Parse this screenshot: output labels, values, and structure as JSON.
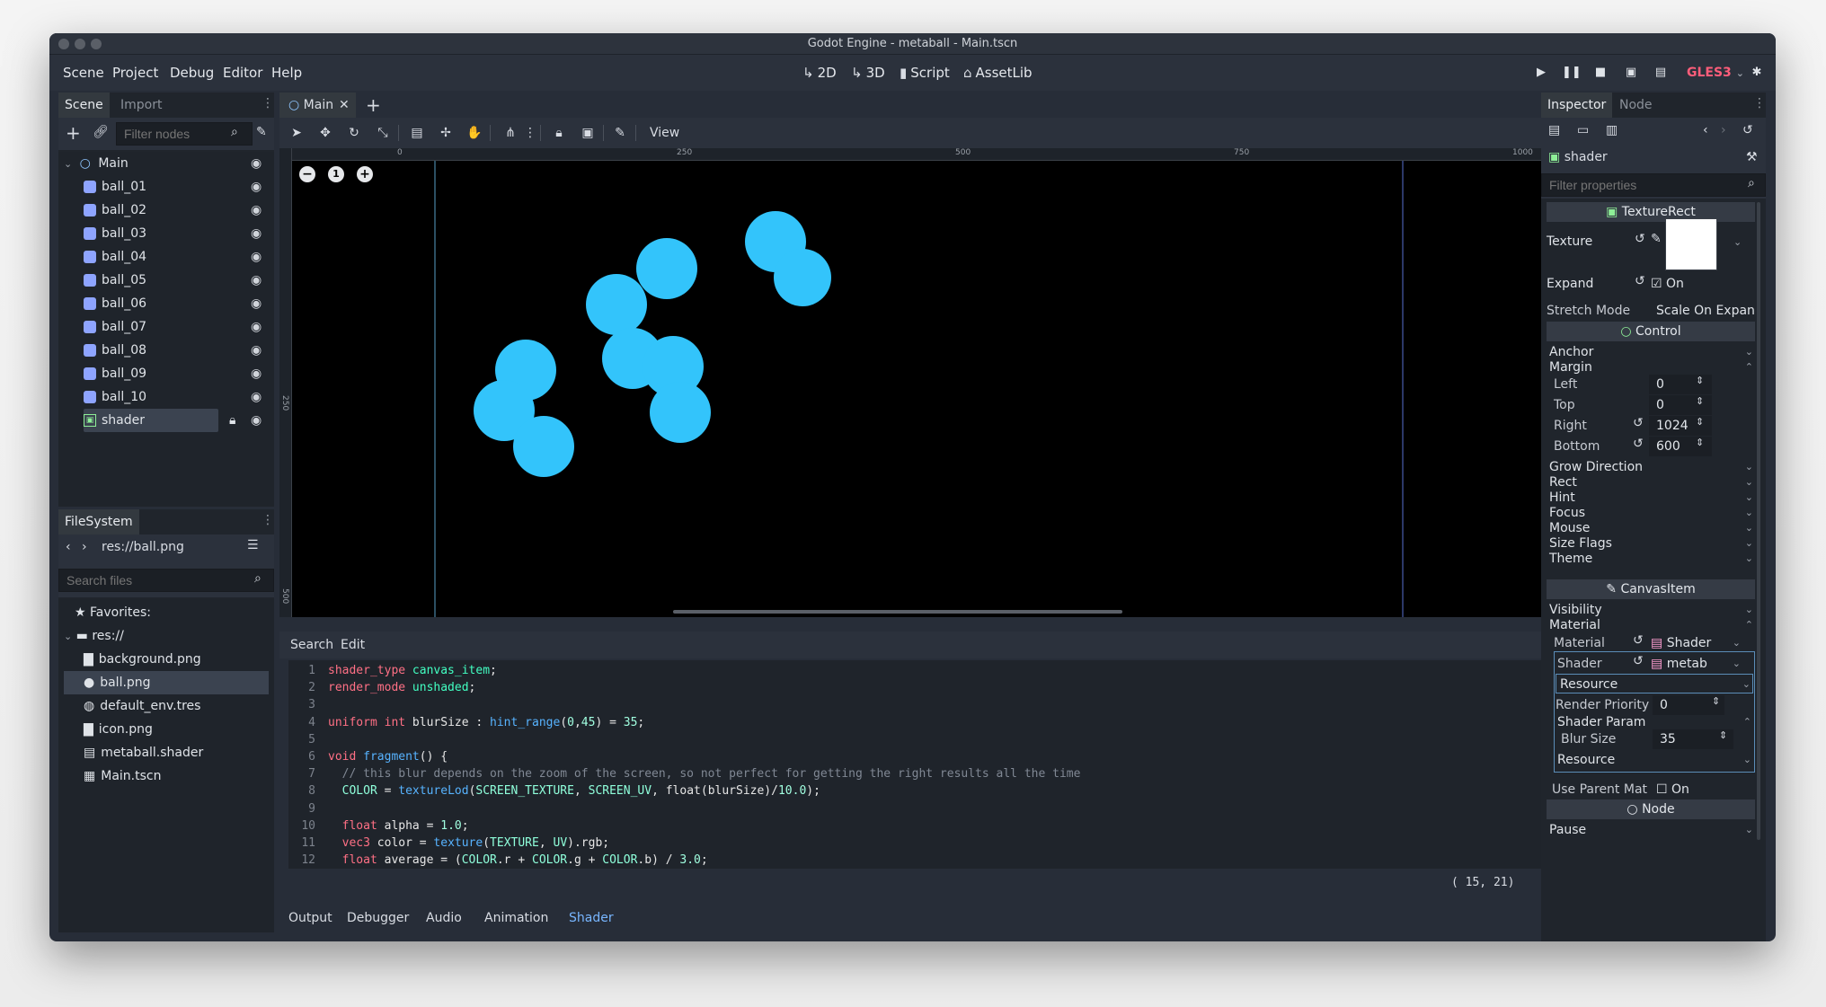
{
  "window": {
    "title": "Godot Engine - metaball - Main.tscn"
  },
  "menu": [
    "Scene",
    "Project",
    "Debug",
    "Editor",
    "Help"
  ],
  "workspaces": [
    {
      "label": "2D",
      "icon": "2d-icon"
    },
    {
      "label": "3D",
      "icon": "3d-icon"
    },
    {
      "label": "Script",
      "icon": "script-icon"
    },
    {
      "label": "AssetLib",
      "icon": "assetlib-icon"
    }
  ],
  "renderer": "GLES3",
  "scene_panel": {
    "tabs": [
      "Scene",
      "Import"
    ],
    "filter_placeholder": "Filter nodes",
    "nodes": [
      {
        "label": "Main",
        "type": "root"
      },
      {
        "label": "ball_01"
      },
      {
        "label": "ball_02"
      },
      {
        "label": "ball_03"
      },
      {
        "label": "ball_04"
      },
      {
        "label": "ball_05"
      },
      {
        "label": "ball_06"
      },
      {
        "label": "ball_07"
      },
      {
        "label": "ball_08"
      },
      {
        "label": "ball_09"
      },
      {
        "label": "ball_10"
      },
      {
        "label": "shader",
        "selected": true
      }
    ]
  },
  "filesystem": {
    "tab": "FileSystem",
    "path": "res://ball.png",
    "search_placeholder": "Search files",
    "favorites": "Favorites:",
    "root": "res://",
    "files": [
      {
        "label": "background.png",
        "icon": "image-icon"
      },
      {
        "label": "ball.png",
        "icon": "ball-image-icon",
        "selected": true
      },
      {
        "label": "default_env.tres",
        "icon": "environment-icon"
      },
      {
        "label": "icon.png",
        "icon": "image-icon"
      },
      {
        "label": "metaball.shader",
        "icon": "shader-file-icon"
      },
      {
        "label": "Main.tscn",
        "icon": "scene-file-icon"
      }
    ]
  },
  "editor_tab": {
    "label": "Main"
  },
  "viewport": {
    "view_menu": "View",
    "ruler_labels": [
      "0",
      "250",
      "500",
      "750",
      "1000"
    ],
    "vruler_labels": [
      "250",
      "500"
    ],
    "zoom_buttons": [
      "zoom-out-icon",
      "zoom-reset-icon",
      "zoom-in-icon"
    ],
    "blob_color": "#33c4fb"
  },
  "script_editor": {
    "menu": [
      "Search",
      "Edit"
    ],
    "lines": [
      {
        "n": "1",
        "code": "shader_type canvas_item;"
      },
      {
        "n": "2",
        "code": "render_mode unshaded;"
      },
      {
        "n": "3",
        "code": ""
      },
      {
        "n": "4",
        "code": "uniform int blurSize : hint_range(0,45) = 35;"
      },
      {
        "n": "5",
        "code": ""
      },
      {
        "n": "6",
        "code": "void fragment() {"
      },
      {
        "n": "7",
        "code": "  // this blur depends on the zoom of the screen, so not perfect for getting the right results all the time"
      },
      {
        "n": "8",
        "code": "  COLOR = textureLod(SCREEN_TEXTURE, SCREEN_UV, float(blurSize)/10.0);"
      },
      {
        "n": "9",
        "code": ""
      },
      {
        "n": "10",
        "code": "  float alpha = 1.0;"
      },
      {
        "n": "11",
        "code": "  vec3 color = texture(TEXTURE, UV).rgb;"
      },
      {
        "n": "12",
        "code": "  float average = (COLOR.r + COLOR.g + COLOR.b) / 3.0;"
      }
    ],
    "cursor": "( 15, 21)"
  },
  "bottom_tabs": [
    "Output",
    "Debugger",
    "Audio",
    "Animation",
    "Shader"
  ],
  "inspector": {
    "tabs": [
      "Inspector",
      "Node"
    ],
    "object": "shader",
    "filter_placeholder": "Filter properties",
    "texture_rect": {
      "section": "TextureRect",
      "texture_label": "Texture",
      "expand_label": "Expand",
      "expand_value": "On",
      "stretch_label": "Stretch Mode",
      "stretch_value": "Scale On Expan"
    },
    "control": {
      "section": "Control",
      "anchor": "Anchor",
      "margin": "Margin",
      "left_label": "Left",
      "left_value": "0",
      "top_label": "Top",
      "top_value": "0",
      "right_label": "Right",
      "right_value": "1024",
      "bottom_label": "Bottom",
      "bottom_value": "600",
      "groups": [
        "Grow Direction",
        "Rect",
        "Hint",
        "Focus",
        "Mouse",
        "Size Flags",
        "Theme"
      ]
    },
    "canvas_item": {
      "section": "CanvasItem",
      "visibility": "Visibility",
      "material_group": "Material",
      "material_label": "Material",
      "material_value": "Shader",
      "shader_label": "Shader",
      "shader_value": "metab",
      "resource": "Resource",
      "render_priority_label": "Render Priority",
      "render_priority_value": "0",
      "shader_param": "Shader Param",
      "blur_label": "Blur Size",
      "blur_value": "35",
      "resource2": "Resource",
      "use_parent_label": "Use Parent Mat",
      "use_parent_value": "On"
    },
    "node": {
      "section": "Node",
      "pause": "Pause"
    }
  }
}
